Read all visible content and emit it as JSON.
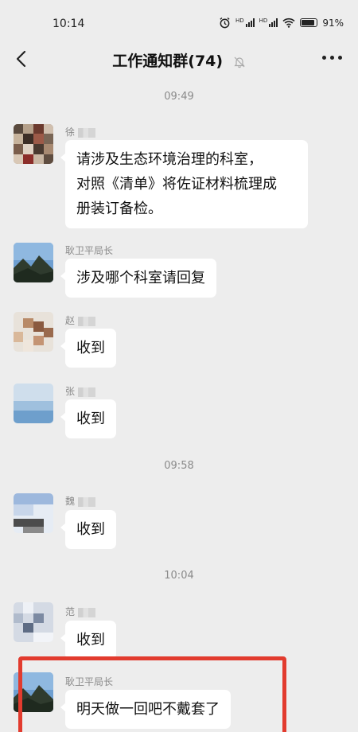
{
  "status": {
    "time": "10:14",
    "network_badges": [
      "HD",
      "HD"
    ],
    "battery_percent": "91%"
  },
  "header": {
    "title": "工作通知群(74)",
    "back_icon": "chevron-left-icon",
    "mute_icon": "bell-off-icon",
    "more_icon": "more-dots-icon"
  },
  "messages": [
    {
      "type": "time",
      "text": "09:49"
    },
    {
      "type": "msg",
      "sender": "徐",
      "sender_redacted": true,
      "text_lines": [
        "请涉及生态环境治理的科室，",
        "对照《清单》将佐证材料梳理成",
        "册装订备检。"
      ]
    },
    {
      "type": "msg",
      "sender": "耿卫平局长",
      "sender_redacted": false,
      "text_lines": [
        "涉及哪个科室请回复"
      ]
    },
    {
      "type": "msg",
      "sender": "赵",
      "sender_redacted": true,
      "text_lines": [
        "收到"
      ]
    },
    {
      "type": "msg",
      "sender": "张",
      "sender_redacted": true,
      "text_lines": [
        "收到"
      ]
    },
    {
      "type": "time",
      "text": "09:58"
    },
    {
      "type": "msg",
      "sender": "魏",
      "sender_redacted": true,
      "text_lines": [
        "收到"
      ]
    },
    {
      "type": "time",
      "text": "10:04"
    },
    {
      "type": "msg",
      "sender": "范",
      "sender_redacted": true,
      "text_lines": [
        "收到"
      ]
    },
    {
      "type": "msg",
      "sender": "耿卫平局长",
      "sender_redacted": false,
      "text_lines": [
        "明天做一回吧不戴套了"
      ],
      "highlighted": true
    }
  ],
  "colors": {
    "background": "#ededed",
    "bubble": "#ffffff",
    "highlight": "#e23b2e",
    "meta_text": "#8a8a8a"
  }
}
